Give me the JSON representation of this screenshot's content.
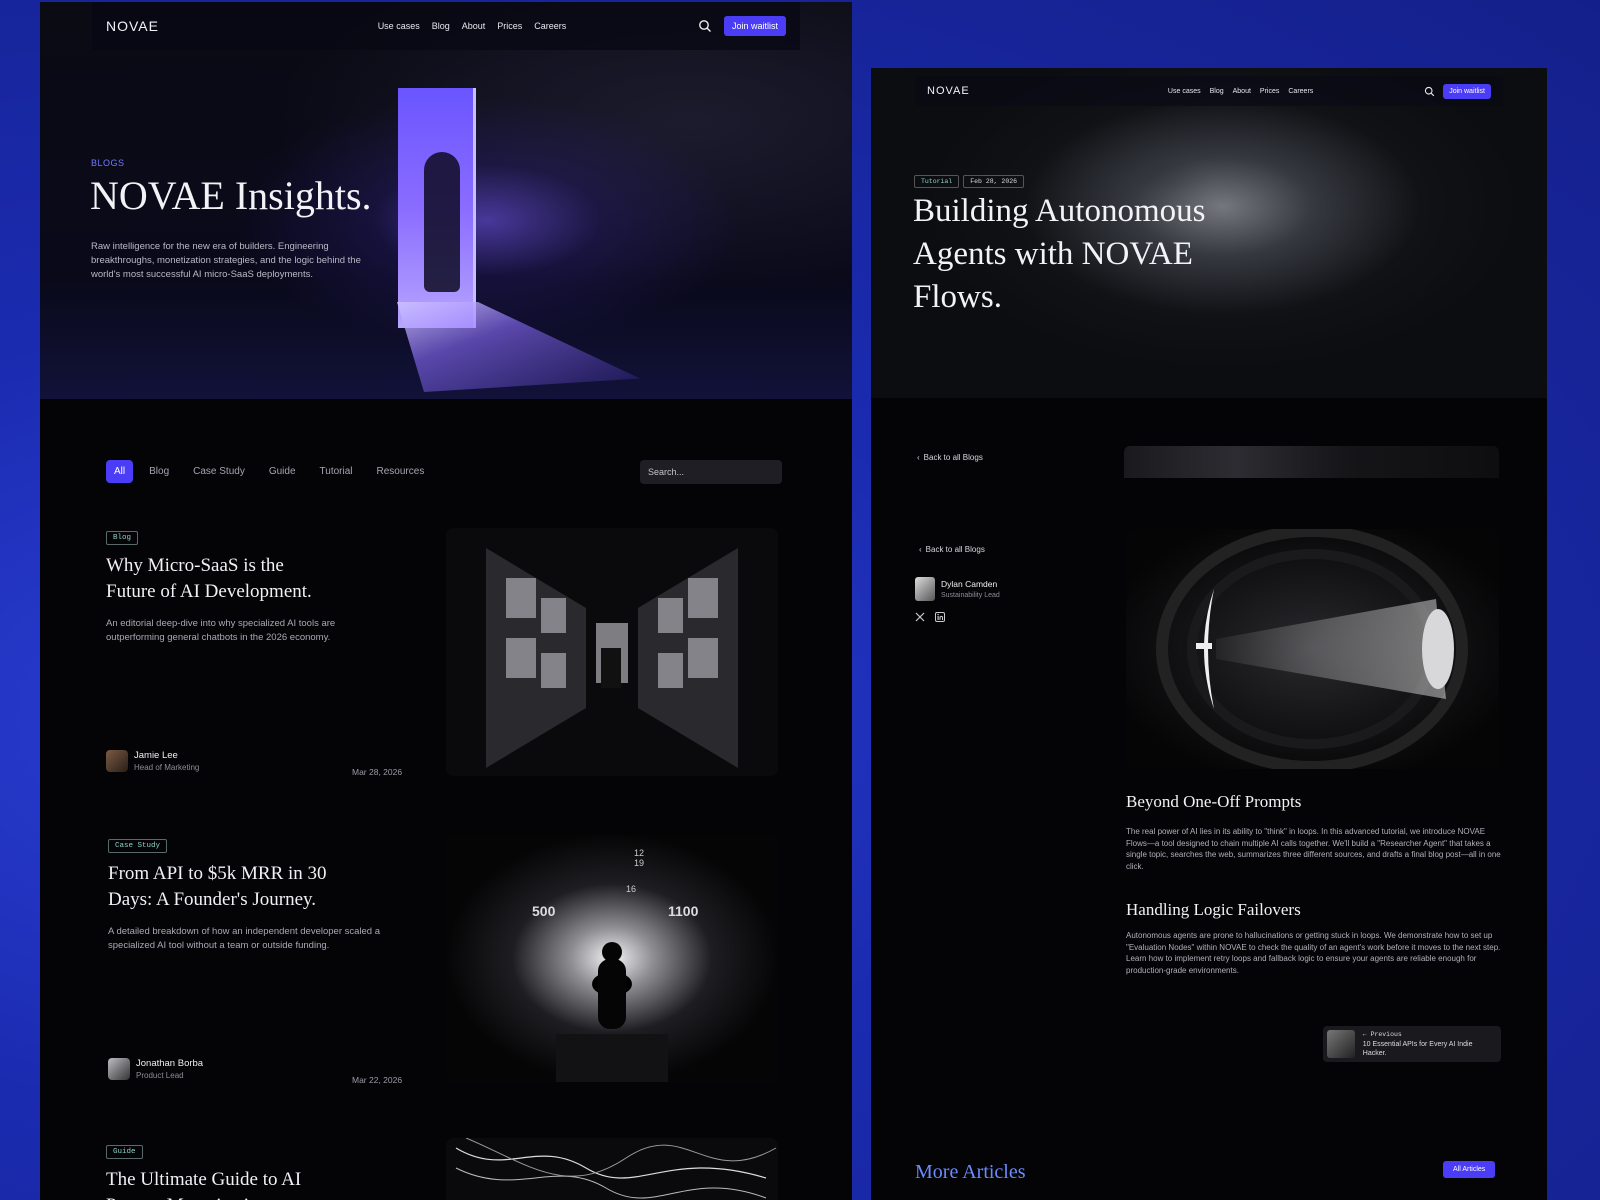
{
  "brand": {
    "accent": "#4a3df5",
    "tag_color": "#8fd1c9",
    "more_color": "#6b8bff"
  },
  "nav": {
    "logo": "NOVAE",
    "links": [
      "Use cases",
      "Blog",
      "About",
      "Prices",
      "Careers"
    ],
    "cta": "Join waitlist",
    "search_icon": "search-icon"
  },
  "left": {
    "hero": {
      "eyebrow": "BLOGS",
      "title": "NOVAE Insights.",
      "description": "Raw intelligence for the new era of builders. Engineering breakthroughs, monetization strategies, and the logic behind the world's most successful AI micro-SaaS deployments."
    },
    "filters": [
      "All",
      "Blog",
      "Case Study",
      "Guide",
      "Tutorial",
      "Resources"
    ],
    "active_filter": "All",
    "search_placeholder": "Search...",
    "cards": [
      {
        "tag": "Blog",
        "title": "Why Micro-SaaS is the Future of AI Development.",
        "description": "An editorial deep-dive into why specialized AI tools are outperforming general chatbots in the 2026 economy.",
        "author": "Jamie Lee",
        "role": "Head of Marketing",
        "date": "Mar 28, 2026"
      },
      {
        "tag": "Case Study",
        "title": "From API to $5k MRR in 30 Days: A Founder's Journey.",
        "description": "A detailed breakdown of how an independent developer scaled a specialized AI tool without a team or outside funding.",
        "author": "Jonathan Borba",
        "role": "Product Lead",
        "date": "Mar 22, 2026"
      },
      {
        "tag": "Guide",
        "title": "The Ultimate Guide to AI Prompt Monetization"
      }
    ],
    "dial_numbers": [
      "500",
      "1100",
      "16",
      "12",
      "19"
    ]
  },
  "right": {
    "tags": [
      "Tutorial",
      "Feb 28, 2026"
    ],
    "title": "Building Autonomous Agents with NOVAE Flows.",
    "back_link": "Back to all Blogs",
    "author": {
      "name": "Dylan Camden",
      "role": "Sustainability Lead"
    },
    "sections": [
      {
        "heading": "Beyond One-Off Prompts",
        "body": "The real power of AI lies in its ability to \"think\" in loops. In this advanced tutorial, we introduce NOVAE Flows—a tool designed to chain multiple AI calls together. We'll build a \"Researcher Agent\" that takes a single topic, searches the web, summarizes three different sources, and drafts a final blog post—all in one click."
      },
      {
        "heading": "Handling Logic Failovers",
        "body": "Autonomous agents are prone to hallucinations or getting stuck in loops. We demonstrate how to set up \"Evaluation Nodes\" within NOVAE to check the quality of an agent's work before it moves to the next step. Learn how to implement retry loops and fallback logic to ensure your agents are reliable enough for production-grade environments."
      }
    ],
    "previous": {
      "label": "Previous",
      "title": "10 Essential APIs for Every AI Indie Hacker."
    },
    "more": {
      "title": "More Articles",
      "button": "All Articles"
    }
  }
}
